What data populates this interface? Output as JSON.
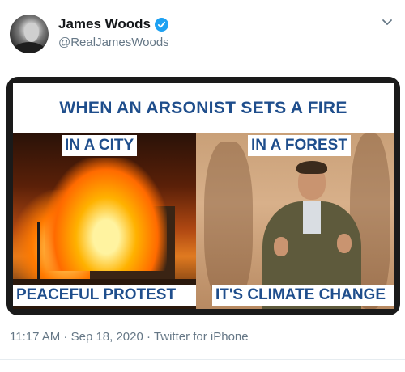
{
  "author": {
    "name": "James Woods",
    "handle": "@RealJamesWoods",
    "verified": true,
    "verified_color": "#1da1f2"
  },
  "media": {
    "headline": "WHEN AN ARSONIST SETS A FIRE",
    "left_top_label": "IN A CITY",
    "right_top_label": "IN A FOREST",
    "left_bottom_label": "PEACEFUL PROTEST",
    "right_bottom_label": "IT'S CLIMATE CHANGE",
    "text_color": "#1f4e8c"
  },
  "tweet_meta": {
    "timestamp": "11:17 AM · Sep 18, 2020 · Twitter for iPhone"
  },
  "icons": {
    "menu": "chevron-down-icon",
    "verified": "verified-badge-icon"
  }
}
